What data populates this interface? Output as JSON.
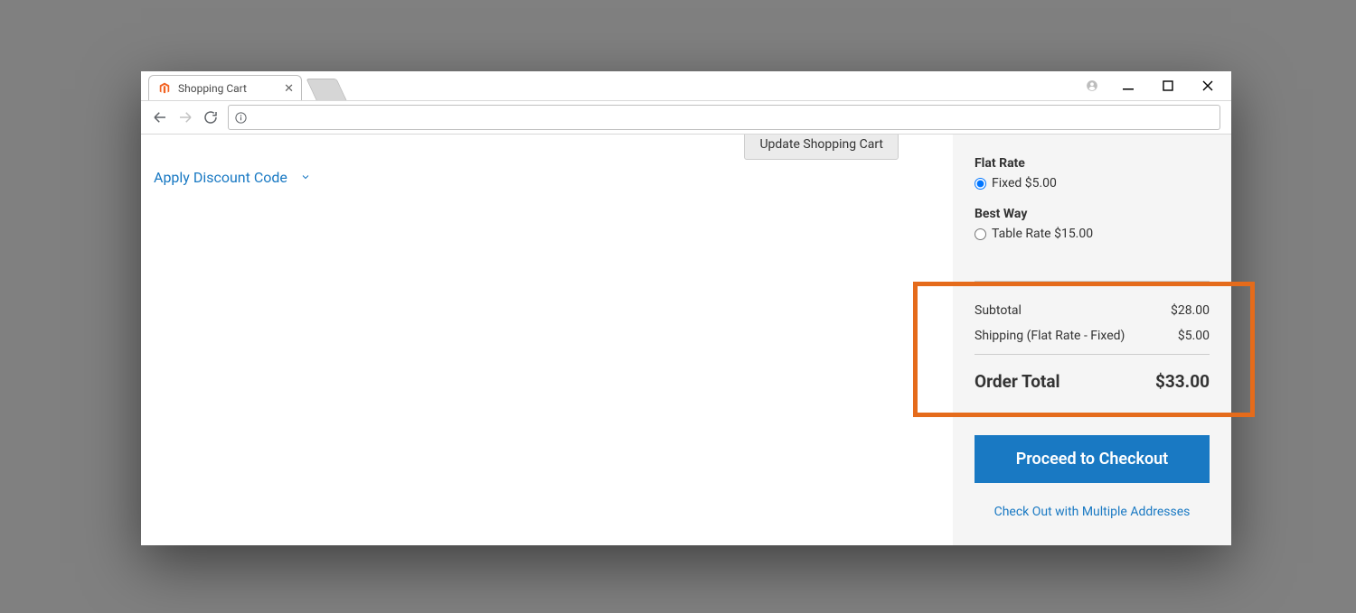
{
  "browser": {
    "tab_title": "Shopping Cart"
  },
  "cart": {
    "update_button": "Update Shopping Cart",
    "discount_toggle": "Apply Discount Code"
  },
  "summary": {
    "shipping_methods": [
      {
        "group_label": "Flat Rate",
        "option_label": "Fixed $5.00",
        "selected": true
      },
      {
        "group_label": "Best Way",
        "option_label": "Table Rate $15.00",
        "selected": false
      }
    ],
    "subtotal_label": "Subtotal",
    "subtotal_value": "$28.00",
    "shipping_label": "Shipping (Flat Rate - Fixed)",
    "shipping_value": "$5.00",
    "order_total_label": "Order Total",
    "order_total_value": "$33.00",
    "checkout_button": "Proceed to Checkout",
    "multi_address_link": "Check Out with Multiple Addresses"
  }
}
